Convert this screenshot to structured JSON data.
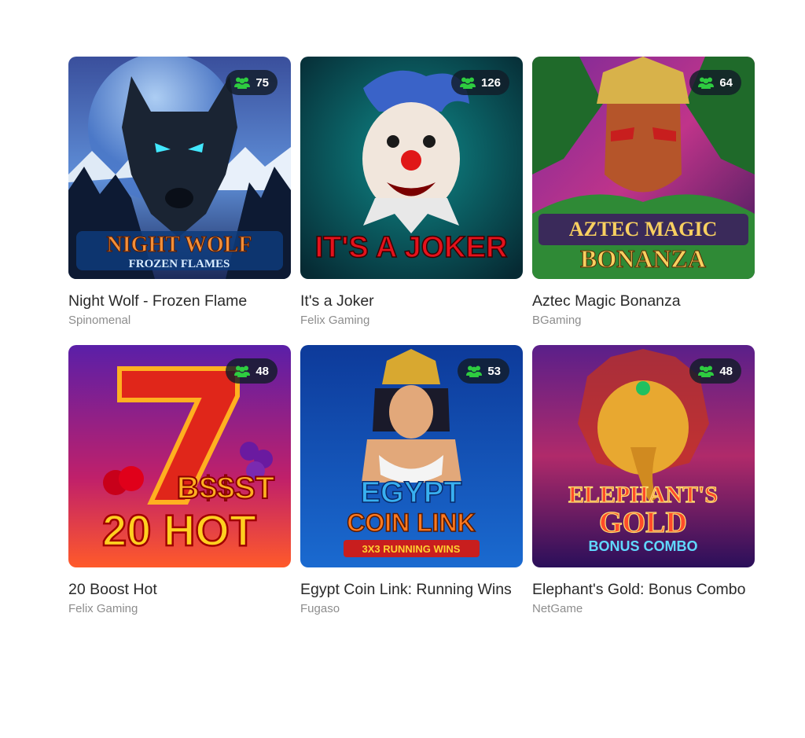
{
  "games": [
    {
      "title": "Night Wolf - Frozen Flame",
      "provider": "Spinomenal",
      "players": "75",
      "logo_top": "NIGHT WOLF",
      "logo_bottom": "FROZEN FLAMES"
    },
    {
      "title": "It's a Joker",
      "provider": "Felix Gaming",
      "players": "126",
      "logo_top": "IT'S A JOKER",
      "logo_bottom": ""
    },
    {
      "title": "Aztec Magic Bonanza",
      "provider": "BGaming",
      "players": "64",
      "logo_top": "AZTEC MAGIC",
      "logo_bottom": "BONANZA"
    },
    {
      "title": "20 Boost Hot",
      "provider": "Felix Gaming",
      "players": "48",
      "logo_top": "B$$ST",
      "logo_bottom": "20 HOT"
    },
    {
      "title": "Egypt Coin Link: Running Wins",
      "provider": "Fugaso",
      "players": "53",
      "logo_top": "EGYPT COIN LINK",
      "logo_bottom": "3X3 RUNNING WINS"
    },
    {
      "title": "Elephant's Gold: Bonus Combo",
      "provider": "NetGame",
      "players": "48",
      "logo_top": "ELEPHANT'S GOLD",
      "logo_bottom": "BONUS COMBO"
    }
  ],
  "icons": {
    "players_badge": "users-icon"
  },
  "colors": {
    "badge_icon": "#2ecc40",
    "title": "#2a2a2a",
    "provider": "#8d8d8d"
  }
}
